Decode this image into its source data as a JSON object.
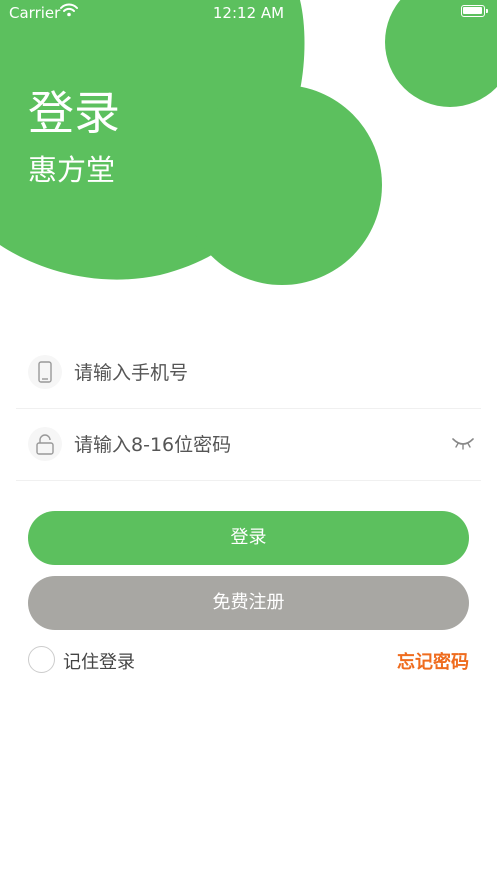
{
  "status_bar": {
    "carrier": "Carrier",
    "time": "12:12 AM"
  },
  "header": {
    "title": "登录",
    "subtitle": "惠方堂"
  },
  "form": {
    "phone": {
      "placeholder": "请输入手机号",
      "icon": "phone-icon"
    },
    "password": {
      "placeholder": "请输入8-16位密码",
      "icon": "lock-icon",
      "toggle_icon": "eye-closed-icon"
    }
  },
  "buttons": {
    "login": "登录",
    "register": "免费注册"
  },
  "options": {
    "remember": "记住登录",
    "forgot": "忘记密码"
  },
  "colors": {
    "brand_green": "#5cc05e",
    "register_gray": "#a8a7a3",
    "forgot_orange": "#ef6c1e"
  }
}
